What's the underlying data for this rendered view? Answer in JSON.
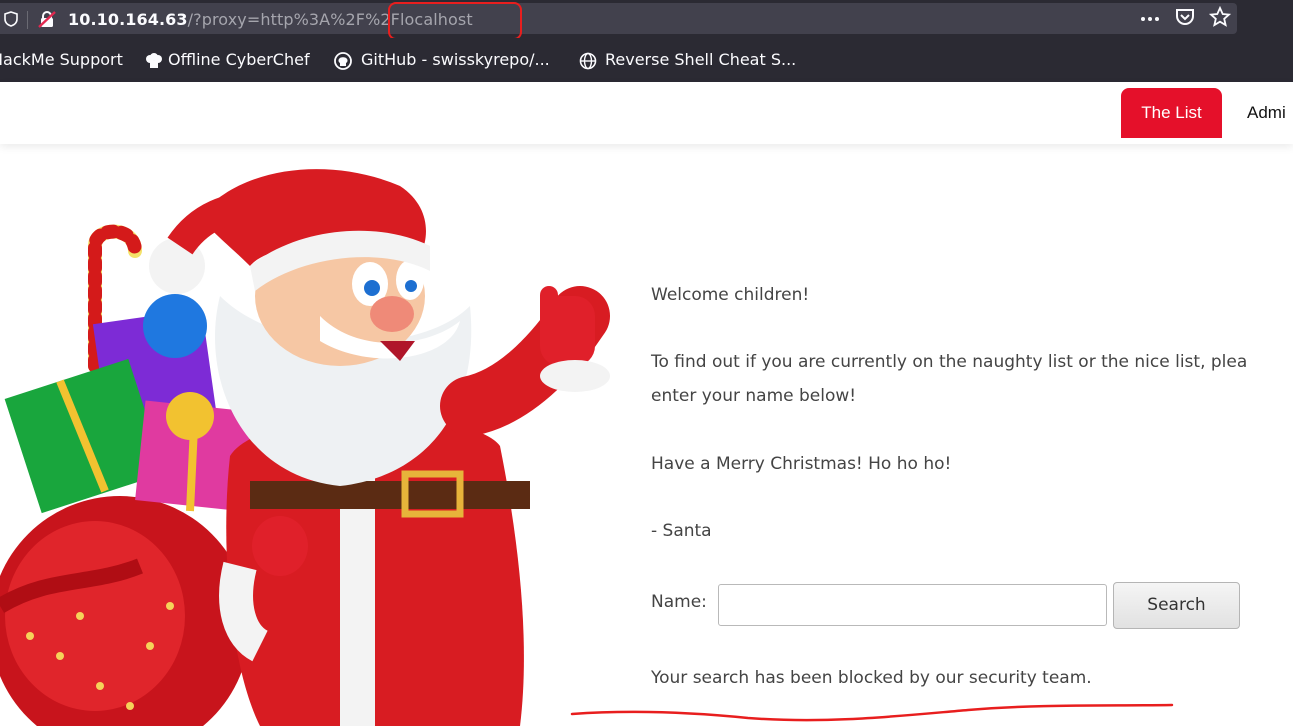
{
  "browser": {
    "url_host": "10.10.164.63",
    "url_path": "/?proxy=http%3A%2F%2Flocalhost",
    "bookmarks": [
      {
        "label": "HackMe Support"
      },
      {
        "label": "Offline CyberChef"
      },
      {
        "label": "GitHub - swisskyrepo/..."
      },
      {
        "label": "Reverse Shell Cheat S..."
      }
    ],
    "icons": [
      "shield-icon",
      "insecure-lock-icon",
      "more-actions-icon",
      "pocket-icon",
      "bookmark-star-icon",
      "chef-hat-icon",
      "github-icon",
      "globe-icon"
    ],
    "annotation_color": "#e81e1e"
  },
  "site": {
    "nav": [
      {
        "label": "The List",
        "active": true
      },
      {
        "label": "Admi"
      }
    ],
    "accent_color": "#e5102a"
  },
  "content": {
    "welcome": "Welcome children!",
    "instructions_line1": "To find out if you are currently on the naughty list or the nice list, plea",
    "instructions_line2": "enter your name below!",
    "greeting": "Have a Merry Christmas! Ho ho ho!",
    "signature": "- Santa",
    "name_label": "Name:",
    "name_value": "",
    "search_label": "Search",
    "result_message": "Your search has been blocked by our security team."
  }
}
